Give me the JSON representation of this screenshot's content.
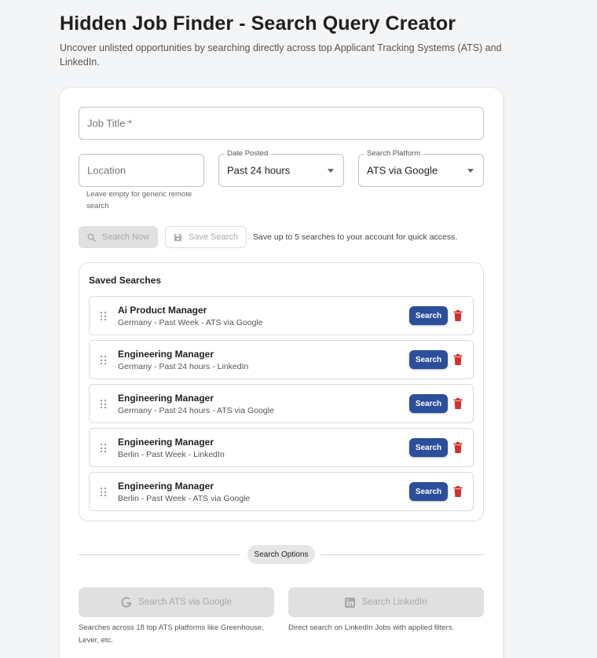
{
  "header": {
    "title": "Hidden Job Finder - Search Query Creator",
    "subtitle": "Uncover unlisted opportunities by searching directly across top Applicant Tracking Systems (ATS) and LinkedIn."
  },
  "form": {
    "job_title_placeholder": "Job Title *",
    "location_placeholder": "Location",
    "location_helper": "Leave empty for generic remote search",
    "date_posted": {
      "label": "Date Posted",
      "value": "Past 24 hours"
    },
    "search_platform": {
      "label": "Search Platform",
      "value": "ATS via Google"
    },
    "search_now_label": "Search Now",
    "save_search_label": "Save Search",
    "save_hint": "Save up to 5 searches to your account for quick access."
  },
  "saved_searches": {
    "heading": "Saved Searches",
    "search_button_label": "Search",
    "items": [
      {
        "title": "Ai Product Manager",
        "subtitle": "Germany - Past Week - ATS via Google"
      },
      {
        "title": "Engineering Manager",
        "subtitle": "Germany - Past 24 hours - LinkedIn"
      },
      {
        "title": "Engineering Manager",
        "subtitle": "Germany - Past 24 hours - ATS via Google"
      },
      {
        "title": "Engineering Manager",
        "subtitle": "Berlin - Past Week - LinkedIn"
      },
      {
        "title": "Engineering Manager",
        "subtitle": "Berlin - Past Week - ATS via Google"
      }
    ]
  },
  "search_options": {
    "chip_label": "Search Options",
    "ats_button_label": "Search ATS via Google",
    "ats_helper": "Searches across 18 top ATS platforms like Greenhouse, Lever, etc.",
    "linkedin_button_label": "Search LinkedIn",
    "linkedin_helper": "Direct search on LinkedIn Jobs with applied filters."
  },
  "colors": {
    "primary_button": "#2b4f9a",
    "delete_icon": "#d32f2f",
    "background": "#f4f5f7"
  },
  "icons": {
    "search_now": "magnifier-icon",
    "save_search": "floppy-disk-icon",
    "drag": "drag-handle-icon",
    "delete": "trash-icon",
    "ats": "google-icon",
    "linkedin": "linkedin-icon",
    "dropdown": "caret-down-icon"
  }
}
